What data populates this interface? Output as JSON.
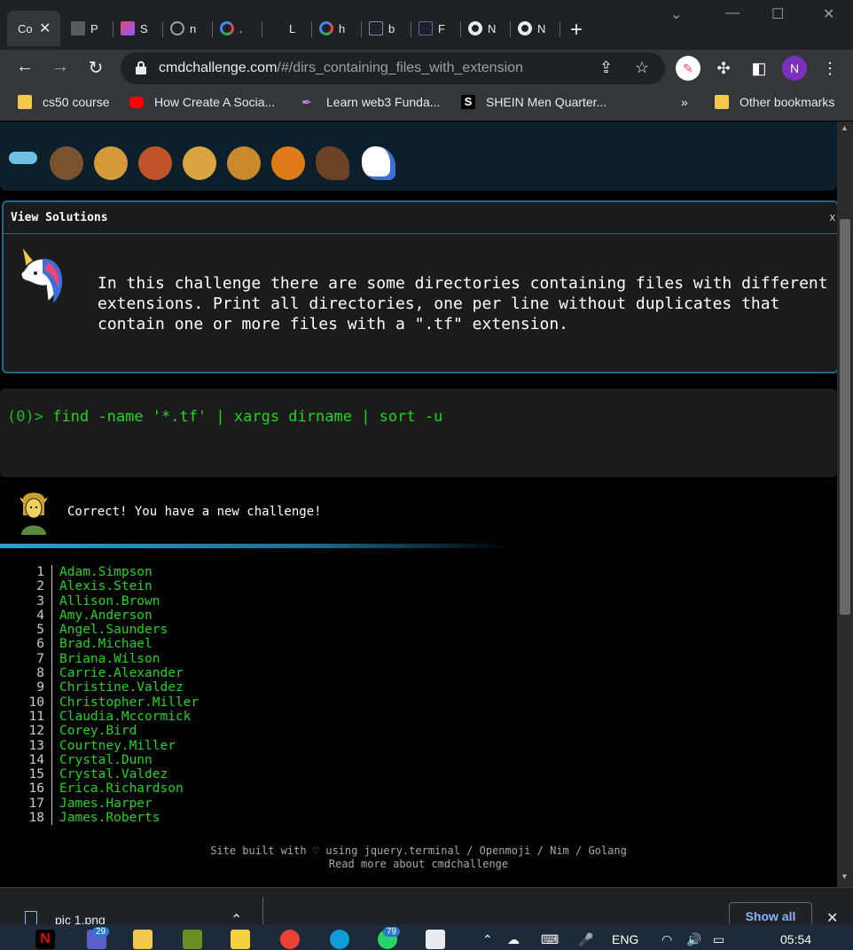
{
  "browser": {
    "tabs": [
      {
        "title": "Co",
        "favicon_color": "#1b1b1b"
      },
      {
        "title": "P",
        "favicon_color": "#5a5a5a"
      },
      {
        "title": "S",
        "favicon_color": "#e5467d"
      },
      {
        "title": "n",
        "favicon_color": "#9aa0a6"
      },
      {
        "title": ".",
        "favicon_color": "#4285f4"
      },
      {
        "title": "L",
        "favicon_color": "#202124"
      },
      {
        "title": "h",
        "favicon_color": "#4285f4"
      },
      {
        "title": "b",
        "favicon_color": "#7b8ab8"
      },
      {
        "title": "F",
        "favicon_color": "#c0392b"
      },
      {
        "title": "N",
        "favicon_color": "#ffffff"
      },
      {
        "title": "N",
        "favicon_color": "#ffffff"
      }
    ],
    "url_host": "cmdchallenge.com",
    "url_path": "/#/dirs_containing_files_with_extension",
    "profile_initial": "N",
    "bookmarks": [
      {
        "label": "cs50 course",
        "icon": "folder-icon",
        "color": "#f2c94c"
      },
      {
        "label": "How Create A Socia...",
        "icon": "youtube-icon",
        "color": "#ff0000"
      },
      {
        "label": "Learn web3 Funda...",
        "icon": "feather-icon",
        "color": "#c77dff"
      },
      {
        "label": "SHEIN Men Quarter...",
        "icon": "shein-icon",
        "color": "#000000"
      }
    ],
    "bookmarks_overflow": "»",
    "other_bookmarks": "Other bookmarks"
  },
  "page": {
    "solutions_title": "View Solutions",
    "solutions_close": "x",
    "challenge_text": "In this challenge there are some directories containing files with different extensions. Print all directories, one per line without duplicates that contain one or more files with a \".tf\" extension.",
    "prompt": "(0)>",
    "command": "find -name '*.tf' | xargs dirname | sort -u",
    "result_message": "Correct! You have a new challenge!",
    "output_lines": [
      "Adam.Simpson",
      "Alexis.Stein",
      "Allison.Brown",
      "Amy.Anderson",
      "Angel.Saunders",
      "Brad.Michael",
      "Briana.Wilson",
      "Carrie.Alexander",
      "Christine.Valdez",
      "Christopher.Miller",
      "Claudia.Mccormick",
      "Corey.Bird",
      "Courtney.Miller",
      "Crystal.Dunn",
      "Crystal.Valdez",
      "Erica.Richardson",
      "James.Harper",
      "James.Roberts"
    ],
    "output_numbers": [
      "1",
      "2",
      "3",
      "4",
      "5",
      "6",
      "7",
      "8",
      "9",
      "10",
      "11",
      "12",
      "13",
      "14",
      "15",
      "16",
      "17",
      "18"
    ],
    "footer_line1": "Site built with ♡ using jquery.terminal / Openmoji / Nim / Golang",
    "footer_line2": "Read more about cmdchallenge",
    "animal_colors": [
      "#6ec1e4",
      "#7a5230",
      "#d49a3a",
      "#c0532a",
      "#d9a441",
      "#c98a2e",
      "#e07b1a",
      "#6b4225",
      "#ffffff"
    ]
  },
  "downloads": {
    "file_name": "pic 1.png",
    "show_all": "Show all"
  },
  "taskbar": {
    "badge_teams": "29",
    "badge_whatsapp": "79",
    "language": "ENG",
    "time": "05:54"
  }
}
